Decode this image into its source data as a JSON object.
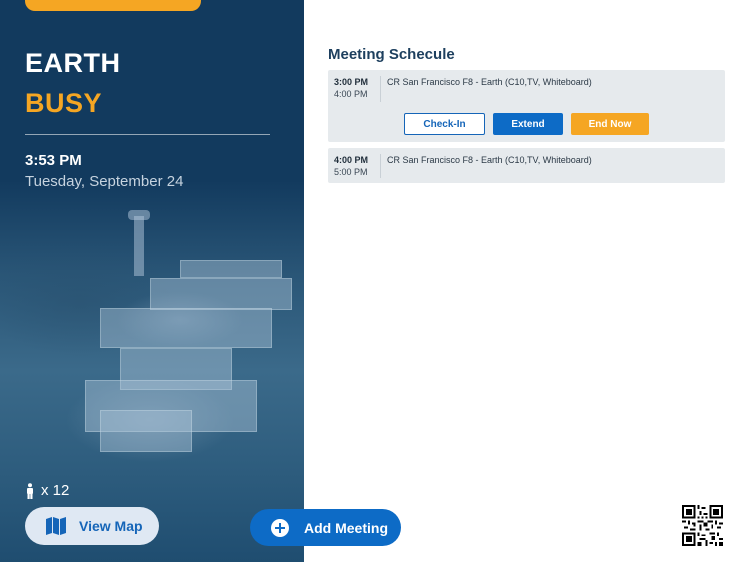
{
  "room": {
    "name": "EARTH",
    "status": "BUSY",
    "time": "3:53 PM",
    "date": "Tuesday, September 24",
    "capacity": "x 12"
  },
  "actions": {
    "view_map": "View Map",
    "add_meeting": "Add Meeting"
  },
  "schedule": {
    "title": "Meeting Schecule",
    "meetings": [
      {
        "start": "3:00 PM",
        "end": "4:00 PM",
        "title": "CR San Francisco F8 - Earth (C10,TV, Whiteboard)",
        "buttons": {
          "check_in": "Check-In",
          "extend": "Extend",
          "end_now": "End Now"
        }
      },
      {
        "start": "4:00 PM",
        "end": "5:00 PM",
        "title": "CR San Francisco F8 - Earth (C10,TV, Whiteboard)"
      }
    ]
  },
  "colors": {
    "panel": "#123a5e",
    "accent_orange": "#f5a623",
    "primary_blue": "#0d6bc6"
  },
  "icons": [
    "person-icon",
    "map-icon",
    "plus-circle-icon",
    "qr-code-icon"
  ]
}
